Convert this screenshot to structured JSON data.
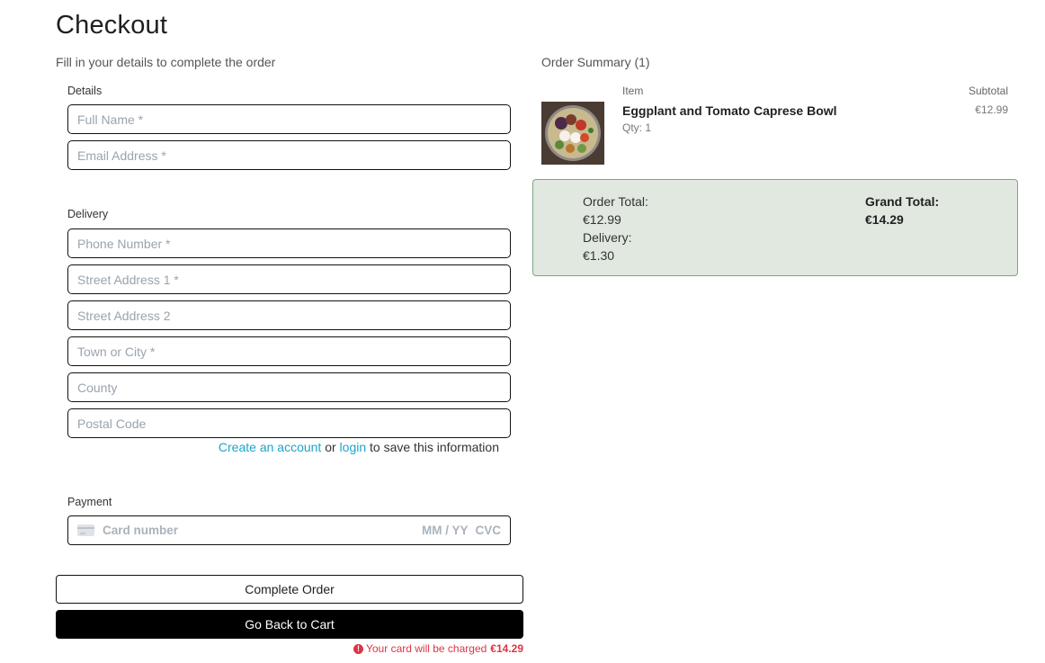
{
  "page": {
    "title": "Checkout",
    "subtitle": "Fill in your details to complete the order"
  },
  "details": {
    "label": "Details",
    "full_name_placeholder": "Full Name *",
    "email_placeholder": "Email Address *"
  },
  "delivery": {
    "label": "Delivery",
    "phone_placeholder": "Phone Number *",
    "street1_placeholder": "Street Address 1 *",
    "street2_placeholder": "Street Address 2",
    "town_placeholder": "Town or City *",
    "county_placeholder": "County",
    "postal_placeholder": "Postal Code"
  },
  "account_prompt": {
    "create_link": "Create an account",
    "or_text": "or",
    "login_link": "login",
    "suffix": "to save this information"
  },
  "payment": {
    "label": "Payment",
    "card_number_placeholder": "Card number",
    "expiry_placeholder": "MM / YY",
    "cvc_placeholder": "CVC",
    "card_icon": "credit-card-icon"
  },
  "actions": {
    "complete_label": "Complete Order",
    "back_label": "Go Back to Cart"
  },
  "charge_notice": {
    "text": "Your card will be charged",
    "amount": "€14.29",
    "icon": "alert-circle-icon",
    "color": "#dc3545"
  },
  "summary": {
    "title": "Order Summary (1)",
    "col_item": "Item",
    "col_subtotal": "Subtotal",
    "items": [
      {
        "name": "Eggplant and Tomato Caprese Bowl",
        "qty": "Qty: 1",
        "price": "€12.99"
      }
    ]
  },
  "totals": {
    "order_total_label": "Order Total:",
    "order_total_value": "€12.99",
    "delivery_label": "Delivery:",
    "delivery_value": "€1.30",
    "grand_total_label": "Grand Total:",
    "grand_total_value": "€14.29",
    "box_color": "#e0e8e0"
  },
  "colors": {
    "link": "#1fa3c9",
    "primary_button": "#000000"
  }
}
